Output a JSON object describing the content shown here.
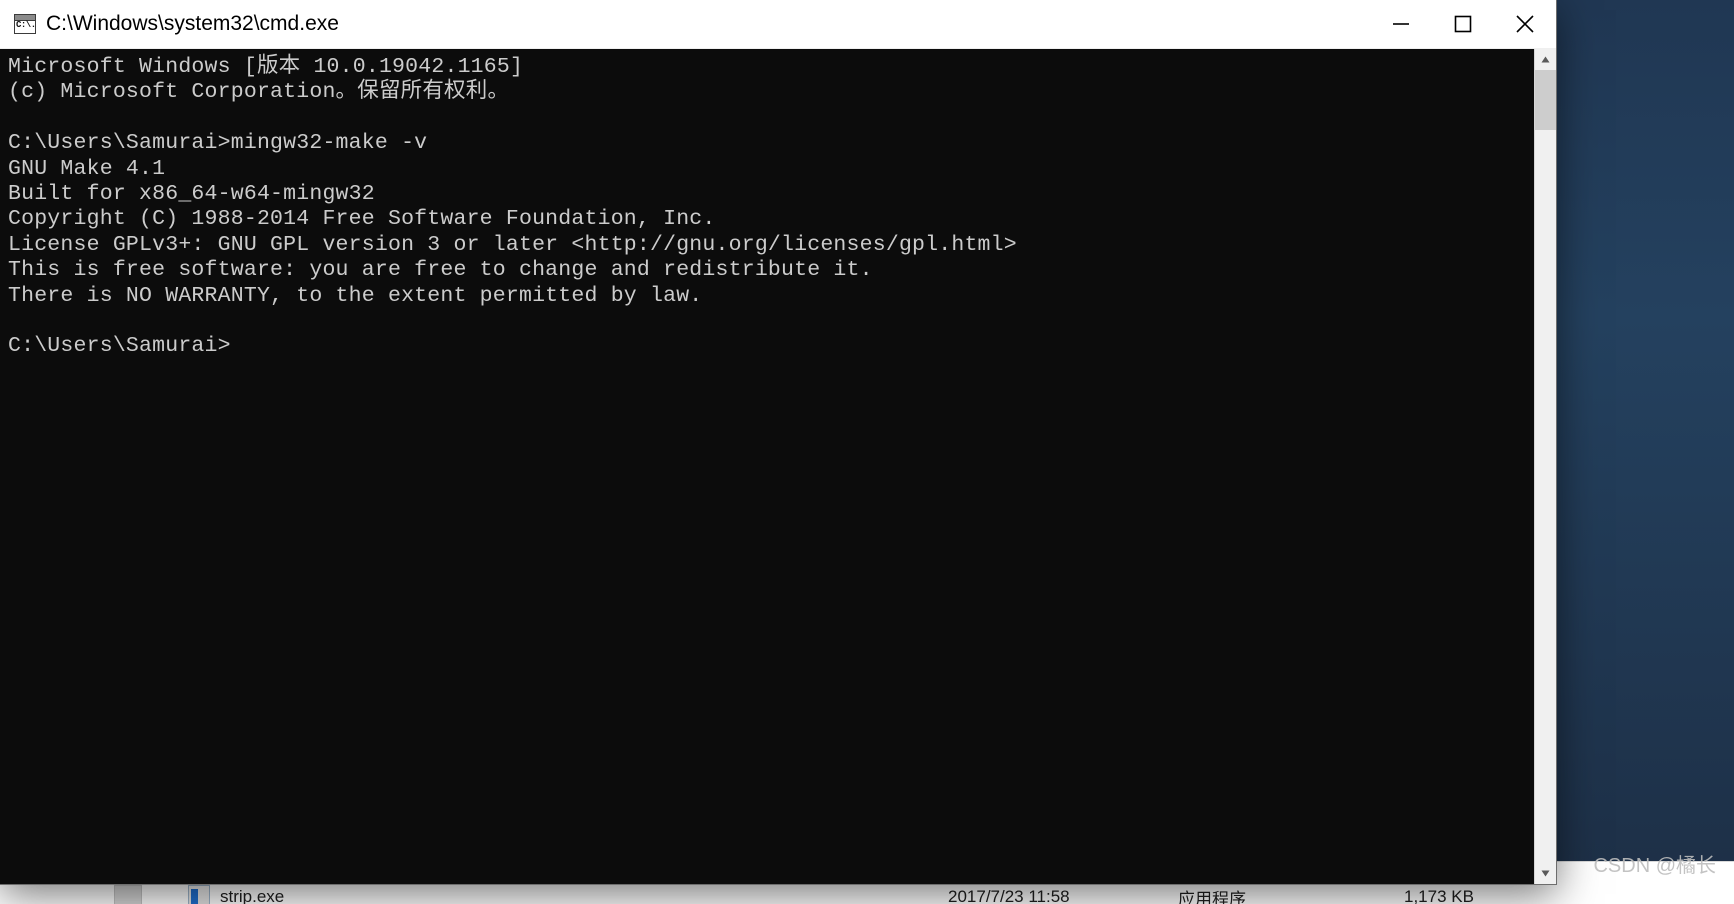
{
  "window": {
    "title": "C:\\Windows\\system32\\cmd.exe",
    "icon": "cmd-icon",
    "icon_text": "C:\\.",
    "controls": {
      "minimize": "minimize-icon",
      "maximize": "maximize-icon",
      "close": "close-icon"
    }
  },
  "terminal": {
    "background": "#0c0c0c",
    "foreground": "#cccccc",
    "lines": [
      "Microsoft Windows [版本 10.0.19042.1165]",
      "(c) Microsoft Corporation。保留所有权利。",
      "",
      "C:\\Users\\Samurai>mingw32-make -v",
      "GNU Make 4.1",
      "Built for x86_64-w64-mingw32",
      "Copyright (C) 1988-2014 Free Software Foundation, Inc.",
      "License GPLv3+: GNU GPL version 3 or later <http://gnu.org/licenses/gpl.html>",
      "This is free software: you are free to change and redistribute it.",
      "There is NO WARRANTY, to the extent permitted by law.",
      "",
      "C:\\Users\\Samurai>"
    ]
  },
  "scrollbar": {
    "up_arrow": "scroll-up-icon",
    "down_arrow": "scroll-down-icon"
  },
  "background_explorer": {
    "row": {
      "name": "strip.exe",
      "date": "2017/7/23 11:58",
      "type": "应用程序",
      "size": "1,173 KB"
    }
  },
  "watermark": {
    "text": "CSDN @橘长"
  }
}
